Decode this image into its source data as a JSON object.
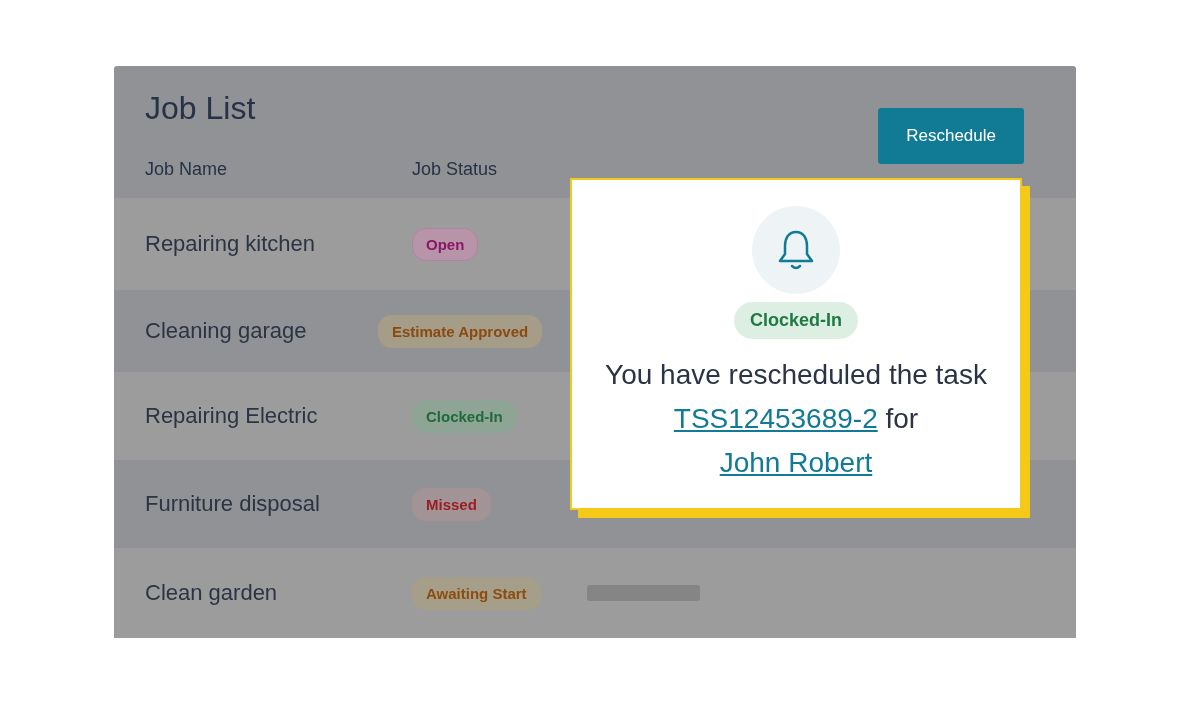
{
  "title": "Job List",
  "reschedule_button": "Reschedule",
  "columns": [
    "Job Name",
    "Job Status"
  ],
  "rows": [
    {
      "name": "Repairing kitchen",
      "status": {
        "label": "Open",
        "kind": "open"
      }
    },
    {
      "name": "Cleaning garage",
      "status": {
        "label": "Estimate Approved",
        "kind": "approved"
      }
    },
    {
      "name": "Repairing Electric",
      "status": {
        "label": "Clocked-In",
        "kind": "clocked"
      }
    },
    {
      "name": "Furniture disposal",
      "status": {
        "label": "Missed",
        "kind": "missed"
      }
    },
    {
      "name": "Clean garden",
      "status": {
        "label": "Awaiting Start",
        "kind": "awaiting"
      },
      "placeholder_bar": true
    }
  ],
  "popup": {
    "badge": {
      "label": "Clocked-In",
      "kind": "clocked"
    },
    "message_before": "You have rescheduled the task",
    "task_link": "TSS12453689-2",
    "message_middle": "for",
    "person_link": "John Robert"
  }
}
